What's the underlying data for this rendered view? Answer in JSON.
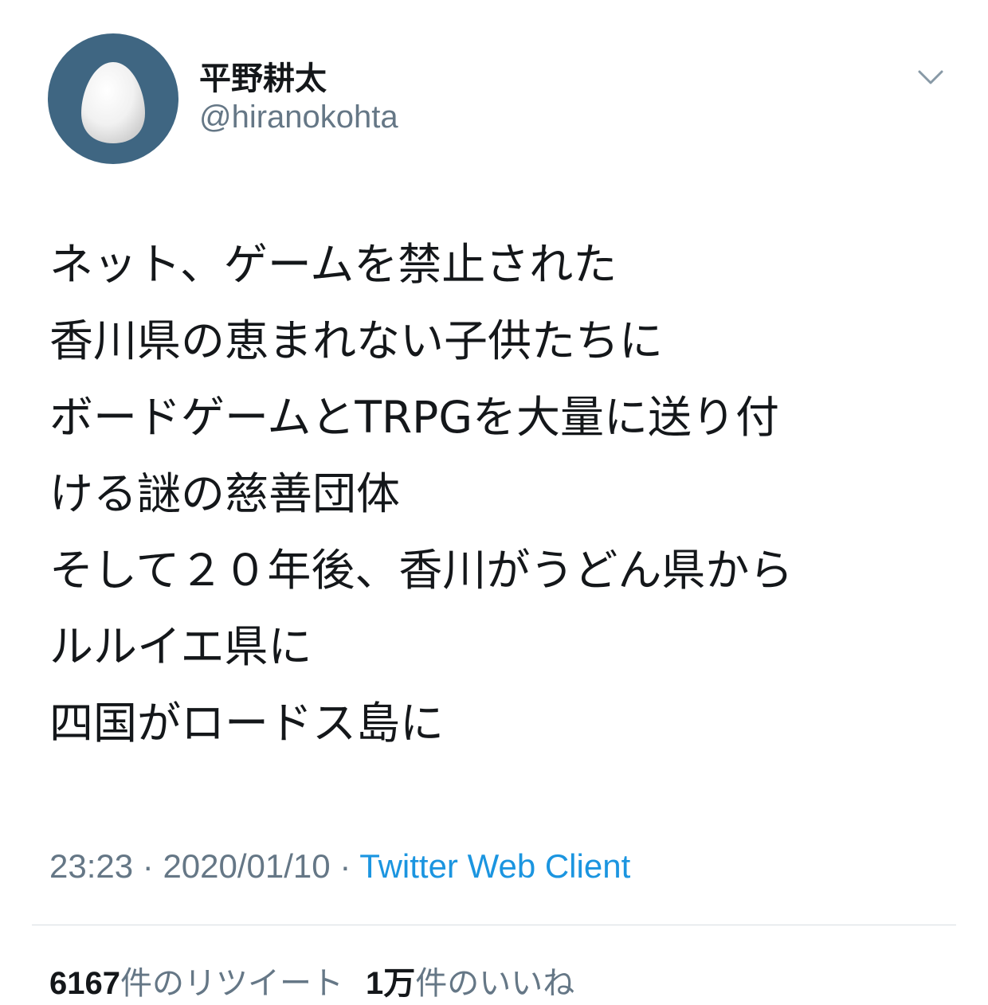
{
  "user": {
    "display_name": "平野耕太",
    "handle": "@hiranokohta",
    "avatar_icon": "default-egg-avatar",
    "avatar_bg": "#3f6682"
  },
  "menu": {
    "caret_icon": "chevron-down-icon"
  },
  "tweet": {
    "lines": [
      "ネット、ゲームを禁止された",
      "香川県の恵まれない子供たちに",
      "ボードゲームとTRPGを大量に送り付",
      "ける謎の慈善団体",
      "そして２０年後、香川がうどん県から",
      "ルルイエ県に",
      "四国がロードス島に"
    ]
  },
  "meta": {
    "time": "23:23",
    "separator": " · ",
    "date": "2020/01/10",
    "source": "Twitter Web Client"
  },
  "stats": {
    "retweets_count": "6167",
    "retweets_label": "件のリツイート",
    "likes_count": "1万",
    "likes_label": "件のいいね"
  },
  "colors": {
    "text": "#14171a",
    "secondary": "#657786",
    "link": "#1b95e0",
    "divider": "#d8dde2"
  }
}
